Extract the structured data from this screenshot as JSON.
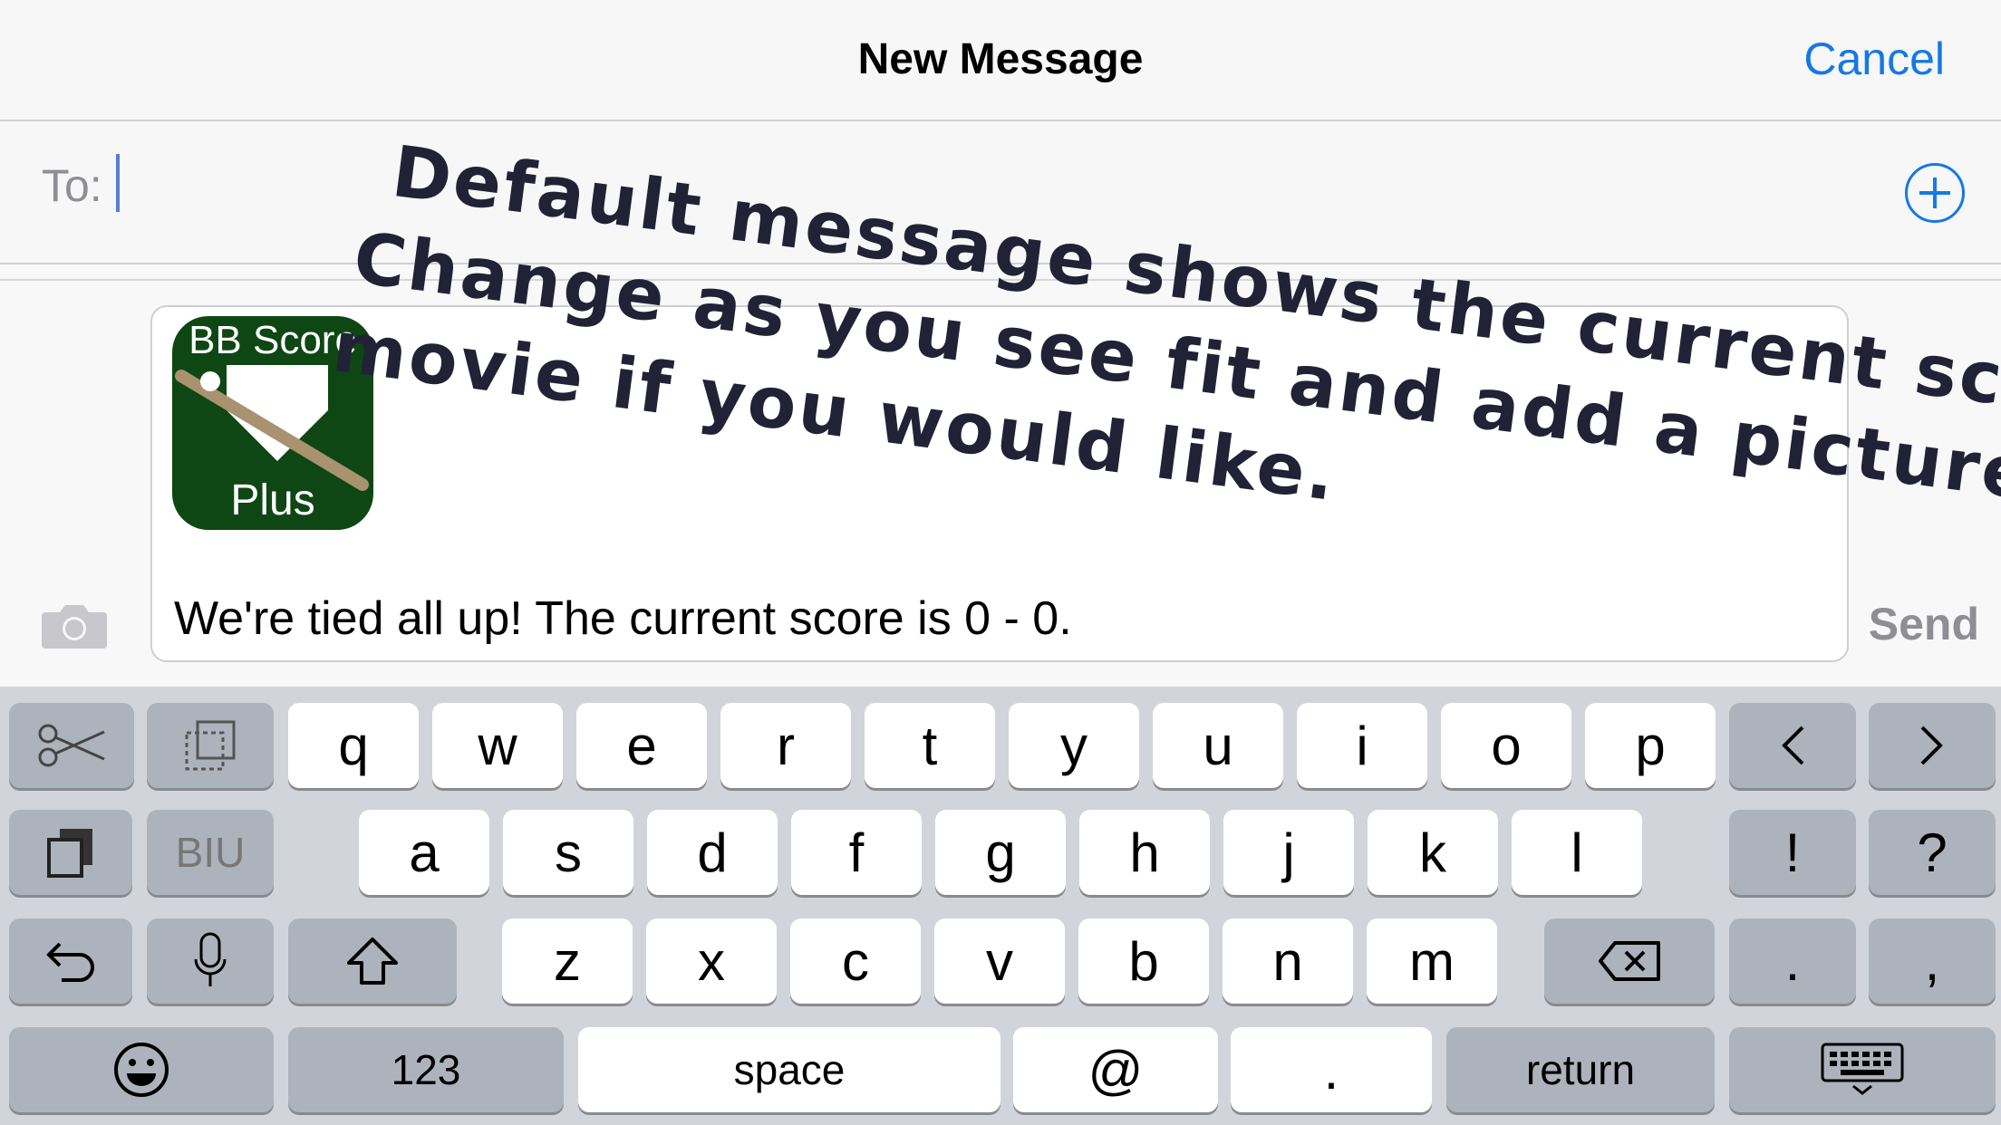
{
  "nav": {
    "title": "New Message",
    "cancel": "Cancel"
  },
  "to": {
    "label": "To:"
  },
  "compose": {
    "app_icon_top": "BB Score",
    "app_icon_bottom": "Plus",
    "message": "We're tied all up!  The current score is 0 - 0.",
    "send": "Send"
  },
  "overlay": {
    "line1": "Default message shows the current score.",
    "line2": "Change as you see fit and add a picture or",
    "line3": "movie if you would like."
  },
  "keyboard": {
    "row1": [
      "q",
      "w",
      "e",
      "r",
      "t",
      "y",
      "u",
      "i",
      "o",
      "p"
    ],
    "row2": [
      "a",
      "s",
      "d",
      "f",
      "g",
      "h",
      "j",
      "k",
      "l"
    ],
    "row3": [
      "z",
      "x",
      "c",
      "v",
      "b",
      "n",
      "m"
    ],
    "punct": [
      "!",
      "?",
      ".",
      ","
    ],
    "format_label": "BIU",
    "numbers": "123",
    "space": "space",
    "at": "@",
    "dot": ".",
    "return": "return",
    "icons": [
      "scissors-icon",
      "copy-icon",
      "paste-icon",
      "undo-icon",
      "microphone-icon",
      "shift-icon",
      "delete-icon",
      "cursor-left-icon",
      "cursor-right-icon",
      "emoji-icon",
      "keyboard-dismiss-icon"
    ]
  },
  "colors": {
    "accent": "#1578e8",
    "keyboard_bg": "#d1d5db",
    "app_icon_green": "#0e4714"
  }
}
